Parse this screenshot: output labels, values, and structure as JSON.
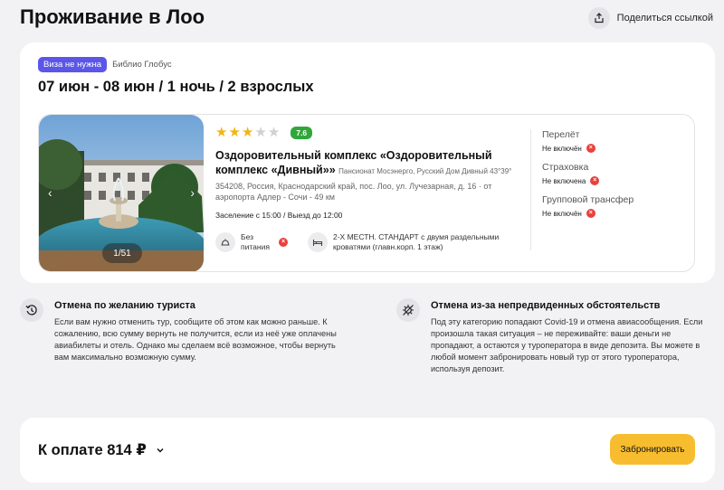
{
  "header": {
    "title": "Проживание в Лоо",
    "share_label": "Поделиться ссылкой"
  },
  "tour": {
    "visa_badge": "Виза не нужна",
    "operator": "Библио Глобус",
    "dates_line": "07 июн - 08 июн / 1 ночь / 2 взрослых"
  },
  "hotel": {
    "stars": 3,
    "stars_max": 5,
    "score": "7.6",
    "name": "Оздоровительный комплекс «Оздоровительный комплекс «Дивный»»",
    "subname": "Пансионат Мосэнерго, Русский Дом Дивный 43°39°",
    "address": "354208, Россия, Краснодарский край, пос. Лоо, ул. Лучезарная, д. 16 · от аэропорта Адлер - Сочи - 49 км",
    "checkin": "Заселение с 15:00 / Выезд до 12:00",
    "photo_counter": "1/51",
    "meal": "Без питания",
    "room": "2-Х МЕСТН. СТАНДАРТ с двумя раздельными кроватями (главн.корп. 1 этаж)"
  },
  "extras": [
    {
      "title": "Перелёт",
      "status": "Не включён"
    },
    {
      "title": "Страховка",
      "status": "Не включена"
    },
    {
      "title": "Групповой трансфер",
      "status": "Не включён"
    }
  ],
  "policies": {
    "tourist": {
      "title": "Отмена по желанию туриста",
      "text": "Если вам нужно отменить тур, сообщите об этом как можно раньше. К сожалению, всю сумму вернуть не получится, если из неё уже оплачены авиабилеты и отель. Однако мы сделаем всё возможное, чтобы вернуть вам максимально возможную сумму."
    },
    "force_majeure": {
      "title": "Отмена из-за непредвиденных обстоятельств",
      "text": "Под эту категорию попадают Covid-19 и отмена авиасообщения. Если произошла такая ситуация – не переживайте: ваши деньги не пропадают, а остаются у туроператора в виде депозита. Вы можете в любой момент забронировать новый тур от этого туроператора, используя депозит."
    }
  },
  "footer": {
    "total": "К оплате 814 ₽",
    "book_label": "Забронировать"
  },
  "colors": {
    "accent_badge": "#5b56e8",
    "score_green": "#31a73a",
    "star": "#f3b413",
    "book_button": "#f7bd2e",
    "cross_red": "#e8413c"
  }
}
